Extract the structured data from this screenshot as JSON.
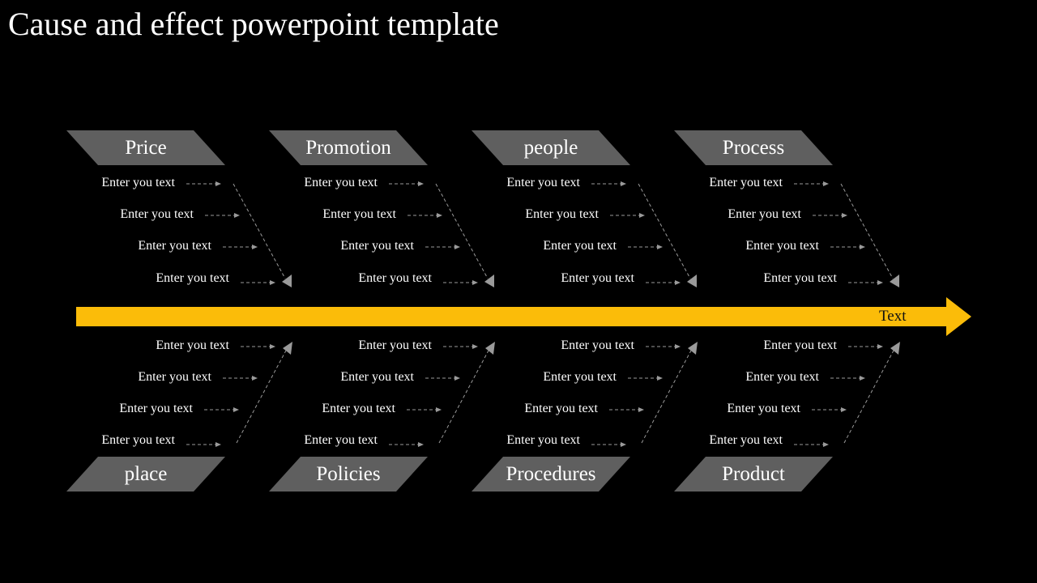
{
  "title": "Cause and effect powerpoint template",
  "colors": {
    "spine": "#fbbc09",
    "category_fill": "#5f5f5f",
    "arrow": "#9a9a9a",
    "text": "#ffffff"
  },
  "effect_label": "Text",
  "top_categories": [
    {
      "label": "Price",
      "items": [
        "Enter you text",
        "Enter you text",
        "Enter you text",
        "Enter you text"
      ]
    },
    {
      "label": "Promotion",
      "items": [
        "Enter you text",
        "Enter you text",
        "Enter you text",
        "Enter you text"
      ]
    },
    {
      "label": "people",
      "items": [
        "Enter you text",
        "Enter you text",
        "Enter you text",
        "Enter you text"
      ]
    },
    {
      "label": "Process",
      "items": [
        "Enter you text",
        "Enter you text",
        "Enter you text",
        "Enter you text"
      ]
    }
  ],
  "bottom_categories": [
    {
      "label": "place",
      "items": [
        "Enter you text",
        "Enter you text",
        "Enter you text",
        "Enter you text"
      ]
    },
    {
      "label": "Policies",
      "items": [
        "Enter you text",
        "Enter you text",
        "Enter you text",
        "Enter you text"
      ]
    },
    {
      "label": "Procedures",
      "items": [
        "Enter you text",
        "Enter you text",
        "Enter you text",
        "Enter you text"
      ]
    },
    {
      "label": "Product",
      "items": [
        "Enter you text",
        "Enter you text",
        "Enter you text",
        "Enter you text"
      ]
    }
  ]
}
